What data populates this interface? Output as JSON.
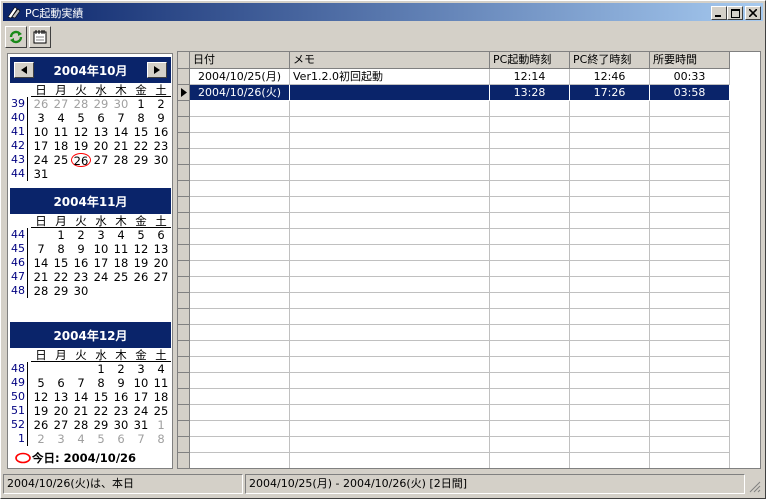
{
  "window": {
    "title": "PC起動実績"
  },
  "months": [
    {
      "title": "2004年10月",
      "weeks": [
        "39",
        "40",
        "41",
        "42",
        "43",
        "44"
      ],
      "dow": [
        "日",
        "月",
        "火",
        "水",
        "木",
        "金",
        "土"
      ],
      "days": [
        [
          "26",
          "dim"
        ],
        [
          "27",
          "dim"
        ],
        [
          "28",
          "dim"
        ],
        [
          "29",
          "dim"
        ],
        [
          "30",
          "dim"
        ],
        [
          "1",
          ""
        ],
        [
          "2",
          ""
        ],
        [
          "3",
          ""
        ],
        [
          "4",
          ""
        ],
        [
          "5",
          ""
        ],
        [
          "6",
          ""
        ],
        [
          "7",
          ""
        ],
        [
          "8",
          ""
        ],
        [
          "9",
          ""
        ],
        [
          "10",
          ""
        ],
        [
          "11",
          ""
        ],
        [
          "12",
          ""
        ],
        [
          "13",
          ""
        ],
        [
          "14",
          ""
        ],
        [
          "15",
          ""
        ],
        [
          "16",
          ""
        ],
        [
          "17",
          ""
        ],
        [
          "18",
          ""
        ],
        [
          "19",
          ""
        ],
        [
          "20",
          ""
        ],
        [
          "21",
          ""
        ],
        [
          "22",
          ""
        ],
        [
          "23",
          ""
        ],
        [
          "24",
          ""
        ],
        [
          "25",
          ""
        ],
        [
          "26",
          "today"
        ],
        [
          "27",
          ""
        ],
        [
          "28",
          ""
        ],
        [
          "29",
          ""
        ],
        [
          "30",
          ""
        ],
        [
          "31",
          ""
        ]
      ]
    },
    {
      "title": "2004年11月",
      "weeks": [
        "44",
        "45",
        "46",
        "47",
        "48"
      ],
      "dow": [
        "日",
        "月",
        "火",
        "水",
        "木",
        "金",
        "土"
      ],
      "days": [
        [
          "",
          ""
        ],
        [
          "1",
          ""
        ],
        [
          "2",
          ""
        ],
        [
          "3",
          ""
        ],
        [
          "4",
          ""
        ],
        [
          "5",
          ""
        ],
        [
          "6",
          ""
        ],
        [
          "7",
          ""
        ],
        [
          "8",
          ""
        ],
        [
          "9",
          ""
        ],
        [
          "10",
          ""
        ],
        [
          "11",
          ""
        ],
        [
          "12",
          ""
        ],
        [
          "13",
          ""
        ],
        [
          "14",
          ""
        ],
        [
          "15",
          ""
        ],
        [
          "16",
          ""
        ],
        [
          "17",
          ""
        ],
        [
          "18",
          ""
        ],
        [
          "19",
          ""
        ],
        [
          "20",
          ""
        ],
        [
          "21",
          ""
        ],
        [
          "22",
          ""
        ],
        [
          "23",
          ""
        ],
        [
          "24",
          ""
        ],
        [
          "25",
          ""
        ],
        [
          "26",
          ""
        ],
        [
          "27",
          ""
        ],
        [
          "28",
          ""
        ],
        [
          "29",
          ""
        ],
        [
          "30",
          ""
        ]
      ]
    },
    {
      "title": "2004年12月",
      "weeks": [
        "48",
        "49",
        "50",
        "51",
        "52",
        "1"
      ],
      "dow": [
        "日",
        "月",
        "火",
        "水",
        "木",
        "金",
        "土"
      ],
      "days": [
        [
          "",
          ""
        ],
        [
          "",
          ""
        ],
        [
          "",
          ""
        ],
        [
          "1",
          ""
        ],
        [
          "2",
          ""
        ],
        [
          "3",
          ""
        ],
        [
          "4",
          ""
        ],
        [
          "5",
          ""
        ],
        [
          "6",
          ""
        ],
        [
          "7",
          ""
        ],
        [
          "8",
          ""
        ],
        [
          "9",
          ""
        ],
        [
          "10",
          ""
        ],
        [
          "11",
          ""
        ],
        [
          "12",
          ""
        ],
        [
          "13",
          ""
        ],
        [
          "14",
          ""
        ],
        [
          "15",
          ""
        ],
        [
          "16",
          ""
        ],
        [
          "17",
          ""
        ],
        [
          "18",
          ""
        ],
        [
          "19",
          ""
        ],
        [
          "20",
          ""
        ],
        [
          "21",
          ""
        ],
        [
          "22",
          ""
        ],
        [
          "23",
          ""
        ],
        [
          "24",
          ""
        ],
        [
          "25",
          ""
        ],
        [
          "26",
          ""
        ],
        [
          "27",
          ""
        ],
        [
          "28",
          ""
        ],
        [
          "29",
          ""
        ],
        [
          "30",
          ""
        ],
        [
          "31",
          ""
        ],
        [
          "1",
          "dim"
        ],
        [
          "2",
          "dim"
        ],
        [
          "3",
          "dim"
        ],
        [
          "4",
          "dim"
        ],
        [
          "5",
          "dim"
        ],
        [
          "6",
          "dim"
        ],
        [
          "7",
          "dim"
        ],
        [
          "8",
          "dim"
        ]
      ]
    }
  ],
  "today_label": "今日: 2004/10/26",
  "table": {
    "columns": [
      "日付",
      "メモ",
      "PC起動時刻",
      "PC終了時刻",
      "所要時間"
    ],
    "rows": [
      [
        "2004/10/25(月)",
        "Ver1.2.0初回起動",
        "12:14",
        "12:46",
        "00:33"
      ],
      [
        "2004/10/26(火)",
        "",
        "13:28",
        "17:26",
        "03:58"
      ]
    ],
    "selected_row": 1
  },
  "status": {
    "left": "2004/10/26(火)は、本日",
    "right": "2004/10/25(月) - 2004/10/26(火) [2日間]"
  }
}
